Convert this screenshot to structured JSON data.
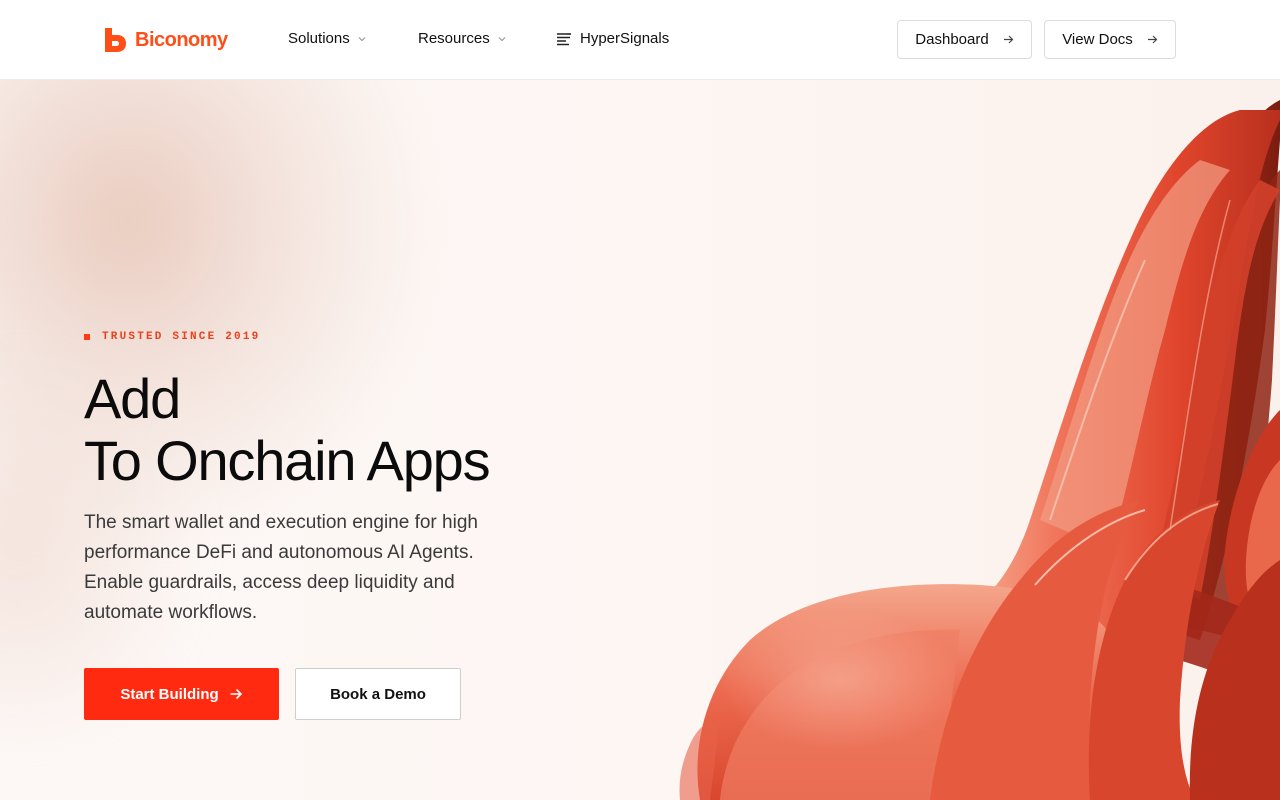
{
  "brand": {
    "name": "Biconomy",
    "color": "#ff4e17"
  },
  "nav": {
    "links": [
      {
        "label": "Solutions",
        "icon": "chevron-down-icon"
      },
      {
        "label": "Resources",
        "icon": "chevron-down-icon"
      },
      {
        "label": "HyperSignals",
        "icon": "hypersignals-icon"
      }
    ],
    "buttons": [
      {
        "label": "Dashboard",
        "icon": "arrow-right-icon"
      },
      {
        "label": "View Docs",
        "icon": "arrow-right-icon"
      }
    ]
  },
  "hero": {
    "eyebrow": "TRUSTED SINCE 2019",
    "headline_line1": "Add",
    "headline_line2": "To Onchain Apps",
    "subtext": "The smart wallet and execution engine for high performance DeFi and autonomous AI Agents. Enable guardrails, access deep liquidity and automate workflows.",
    "primary_cta": "Start Building",
    "secondary_cta": "Book a Demo",
    "accent_color": "#ff2a0f"
  }
}
